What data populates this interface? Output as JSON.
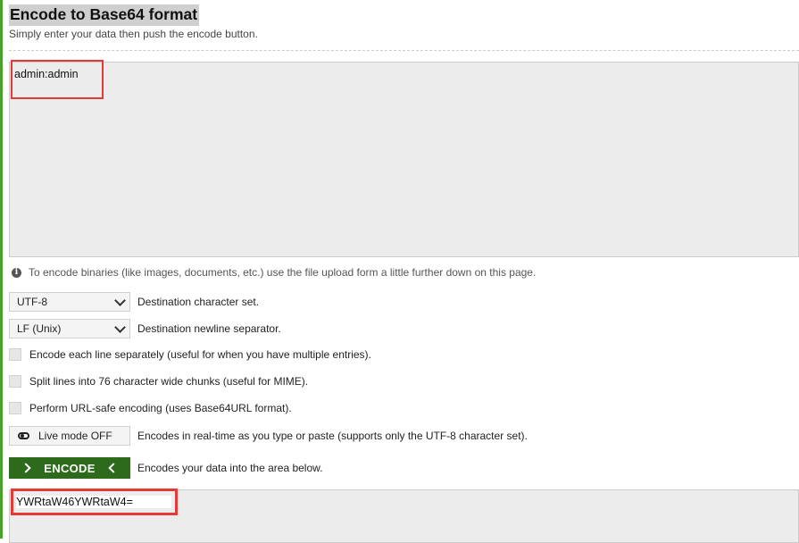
{
  "header": {
    "title": "Encode to Base64 format",
    "subtitle": "Simply enter your data then push the encode button."
  },
  "input": {
    "value": "admin:admin"
  },
  "info": {
    "text": "To encode binaries (like images, documents, etc.) use the file upload form a little further down on this page."
  },
  "options": {
    "charset": {
      "selected": "UTF-8",
      "label": "Destination character set."
    },
    "newline": {
      "selected": "LF (Unix)",
      "label": "Destination newline separator."
    },
    "checkboxes": [
      {
        "label": "Encode each line separately (useful for when you have multiple entries).",
        "checked": false
      },
      {
        "label": "Split lines into 76 character wide chunks (useful for MIME).",
        "checked": false
      },
      {
        "label": "Perform URL-safe encoding (uses Base64URL format).",
        "checked": false
      }
    ],
    "live_mode": {
      "label": "Live mode OFF",
      "description": "Encodes in real-time as you type or paste (supports only the UTF-8 character set)."
    }
  },
  "encode": {
    "label": "ENCODE",
    "description": "Encodes your data into the area below."
  },
  "output": {
    "value": "YWRtaW46YWRtaW4="
  },
  "colors": {
    "accent_green": "#2d6a1c",
    "highlight_red": "#e53935",
    "rail_green": "#49a02c"
  }
}
